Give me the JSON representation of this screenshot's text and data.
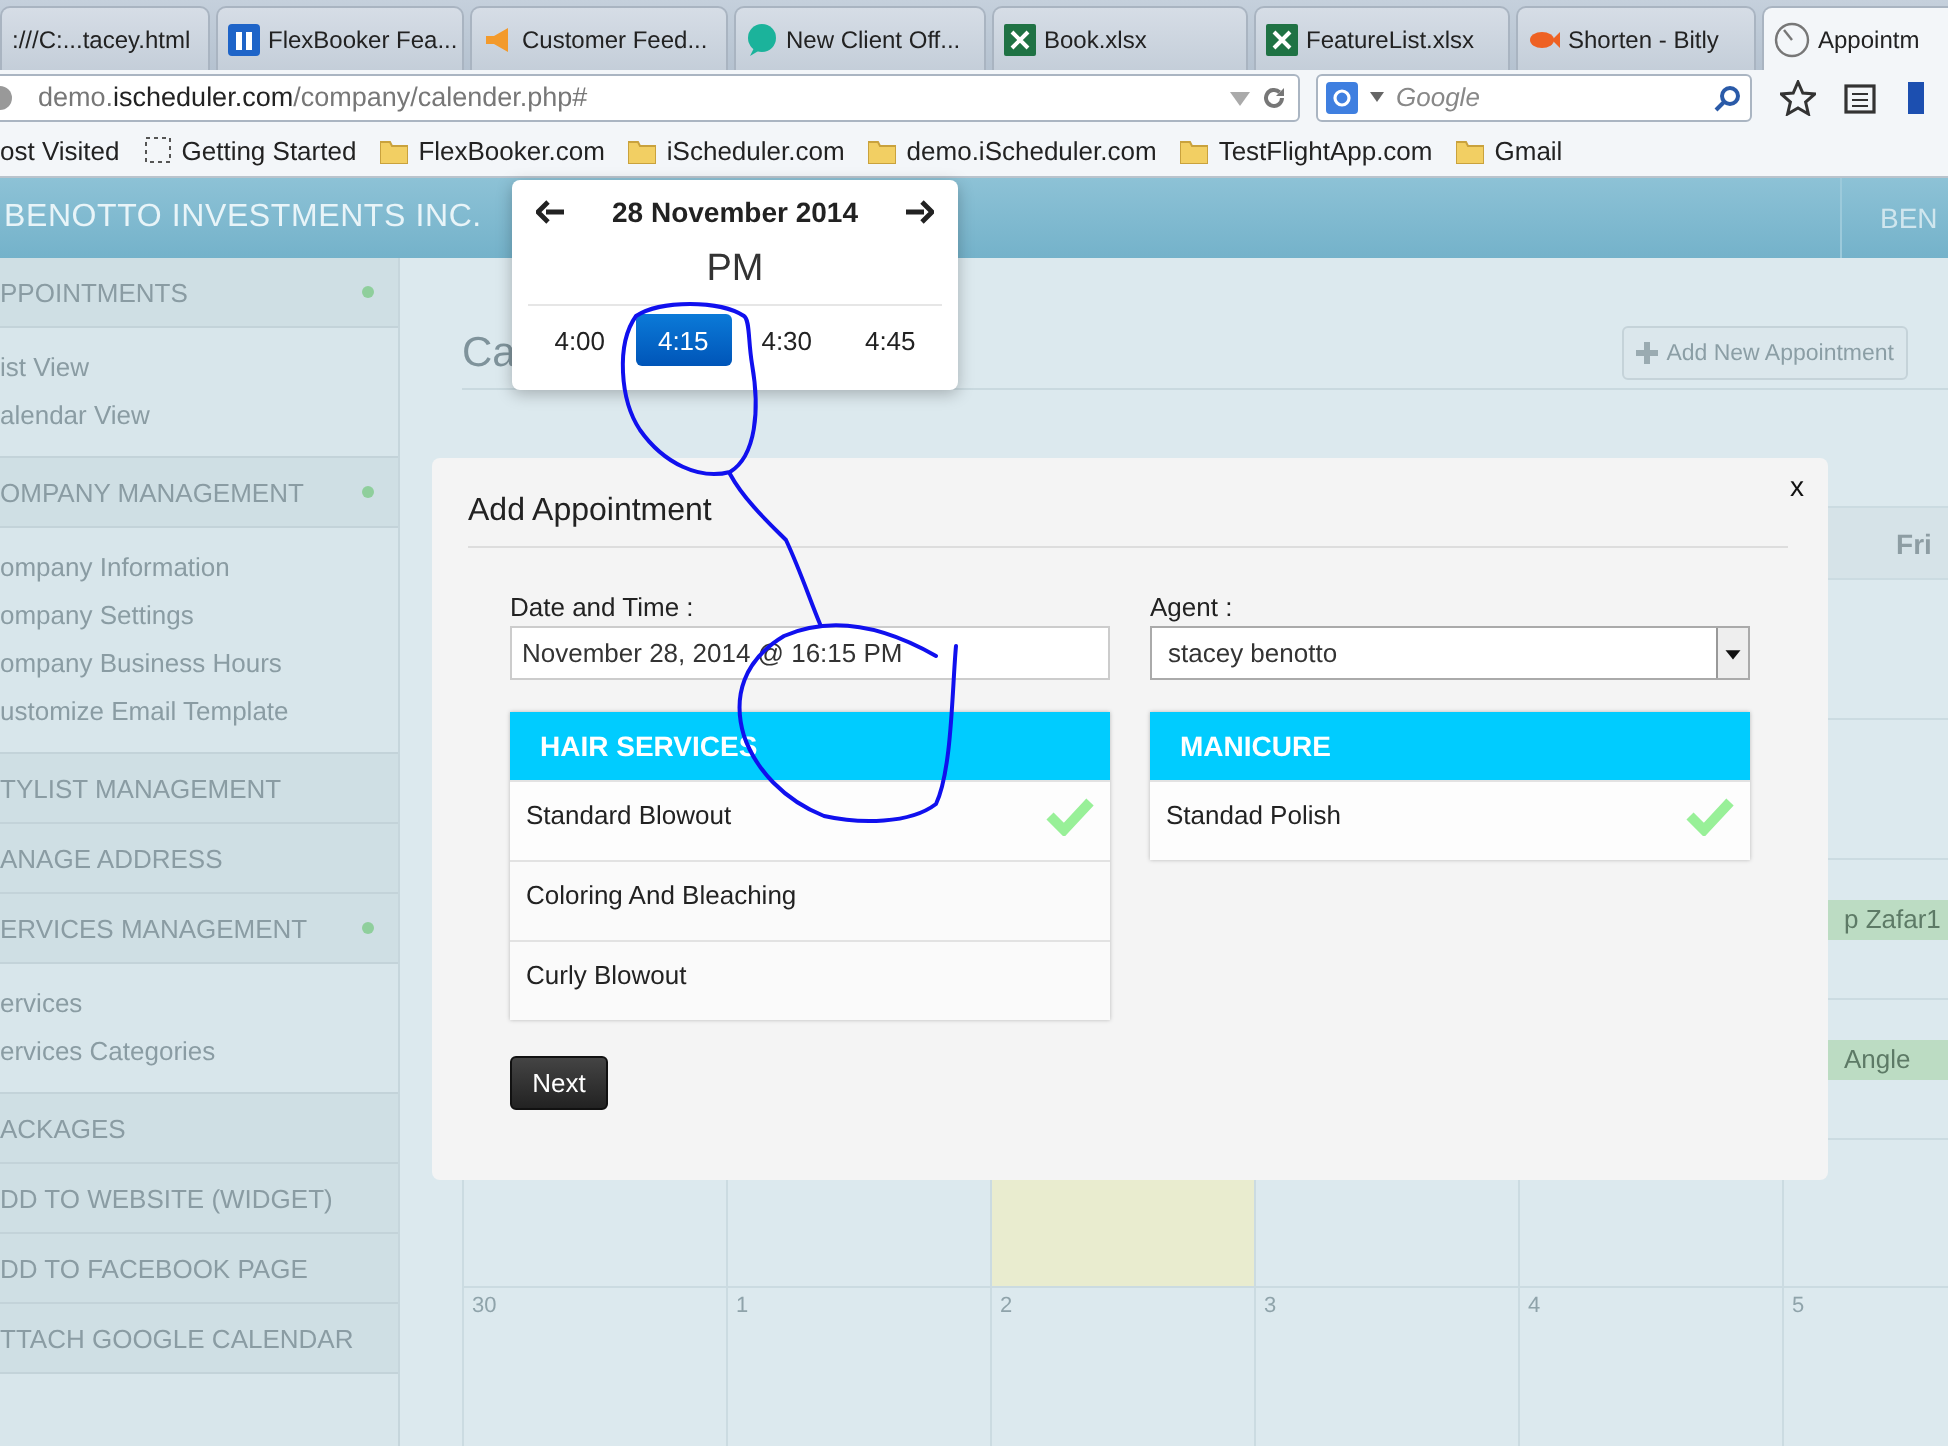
{
  "browser": {
    "tabs": [
      {
        "label": ":///C:...tacey.html",
        "kind": "plain",
        "selected": false
      },
      {
        "label": "FlexBooker Fea...",
        "kind": "fb",
        "selected": false
      },
      {
        "label": "Customer Feed...",
        "kind": "megaphone",
        "selected": false
      },
      {
        "label": "New Client Off...",
        "kind": "bubble",
        "selected": false
      },
      {
        "label": "Book.xlsx",
        "kind": "excel",
        "selected": false
      },
      {
        "label": "FeatureList.xlsx",
        "kind": "excel",
        "selected": false
      },
      {
        "label": "Shorten - Bitly",
        "kind": "bitly",
        "selected": false
      },
      {
        "label": "Appointm",
        "kind": "clock",
        "selected": true
      }
    ],
    "address": [
      {
        "text": "demo.",
        "strong": false
      },
      {
        "text": "ischeduler.com",
        "strong": true
      },
      {
        "text": "/company/calender.php#",
        "strong": false
      }
    ],
    "search": {
      "placeholder": "Google"
    },
    "bookmarks": [
      {
        "label": "ost Visited",
        "kind": "plain"
      },
      {
        "label": "Getting Started",
        "kind": "dashed"
      },
      {
        "label": "FlexBooker.com",
        "kind": "folder"
      },
      {
        "label": "iScheduler.com",
        "kind": "folder"
      },
      {
        "label": "demo.iScheduler.com",
        "kind": "folder"
      },
      {
        "label": "TestFlightApp.com",
        "kind": "folder"
      },
      {
        "label": "Gmail",
        "kind": "folder"
      }
    ]
  },
  "header": {
    "brand": "BENOTTO INVESTMENTS INC.",
    "user": "BEN"
  },
  "sidebar": [
    {
      "title": "PPOINTMENTS",
      "dot": true,
      "items": [
        "ist View",
        "alendar View"
      ]
    },
    {
      "title": "OMPANY MANAGEMENT",
      "dot": true,
      "items": [
        "ompany Information",
        "ompany Settings",
        "ompany Business Hours",
        "ustomize Email Template"
      ]
    },
    {
      "title": "TYLIST MANAGEMENT",
      "dot": false
    },
    {
      "title": "ANAGE ADDRESS",
      "dot": false
    },
    {
      "title": "ERVICES MANAGEMENT",
      "dot": true,
      "items": [
        "ervices",
        "ervices Categories"
      ]
    },
    {
      "title": "ACKAGES",
      "dot": false
    },
    {
      "title": "DD TO WEBSITE (WIDGET)",
      "dot": false
    },
    {
      "title": "DD TO FACEBOOK PAGE",
      "dot": false
    },
    {
      "title": "TTACH GOOGLE CALENDAR",
      "dot": false
    }
  ],
  "page": {
    "title": "Ca",
    "add_button": "Add New Appointment"
  },
  "calendar": {
    "weekday": "Fri",
    "events": [
      {
        "text": "p Zafar1"
      },
      {
        "text": "Angle"
      }
    ],
    "week_cells": [
      {
        "highlighted": false
      },
      {
        "highlighted": false
      },
      {
        "highlighted": true
      },
      {
        "highlighted": false
      },
      {
        "highlighted": false
      },
      {
        "highlighted": false
      }
    ],
    "day_numbers": [
      "30",
      "1",
      "2",
      "3",
      "4",
      "5"
    ]
  },
  "time_picker": {
    "title": "28 November 2014",
    "meridiem": "PM",
    "times": [
      {
        "label": "4:00",
        "selected": false
      },
      {
        "label": "4:15",
        "selected": true
      },
      {
        "label": "4:30",
        "selected": false
      },
      {
        "label": "4:45",
        "selected": false
      }
    ]
  },
  "modal": {
    "title": "Add Appointment",
    "close": "x",
    "date_label": "Date and Time :",
    "date_value": "November 28, 2014 @ 16:15 PM",
    "agent_label": "Agent :",
    "agent_value": "stacey benotto",
    "groups": [
      {
        "title": "HAIR SERVICES",
        "services": [
          {
            "name": "Standard Blowout",
            "selected": true
          },
          {
            "name": "Coloring And Bleaching",
            "selected": false
          },
          {
            "name": "Curly Blowout",
            "selected": false
          }
        ]
      },
      {
        "title": "MANICURE",
        "services": [
          {
            "name": "Standad Polish",
            "selected": true
          }
        ]
      }
    ],
    "next_button": "Next"
  }
}
